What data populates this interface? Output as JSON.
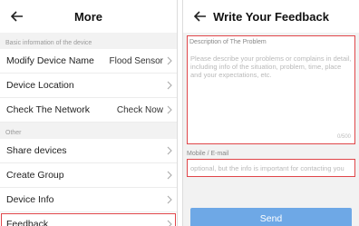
{
  "left": {
    "title": "More",
    "sections": [
      {
        "header": "Basic information of the device",
        "rows": [
          {
            "label": "Modify Device Name",
            "value": "Flood Sensor"
          },
          {
            "label": "Device Location",
            "value": ""
          },
          {
            "label": "Check The Network",
            "value": "Check Now"
          }
        ]
      },
      {
        "header": "Other",
        "rows": [
          {
            "label": "Share devices",
            "value": ""
          },
          {
            "label": "Create Group",
            "value": ""
          },
          {
            "label": "Device Info",
            "value": ""
          },
          {
            "label": "Feedback",
            "value": ""
          }
        ]
      }
    ]
  },
  "right": {
    "title": "Write Your Feedback",
    "problem_label": "Description of The Problem",
    "problem_placeholder": "Please describe your problems or complains in detail, including info of the situation, problem, time, place and your expectations, etc.",
    "counter": "0/500",
    "contact_label": "Mobile / E-mail",
    "contact_placeholder": "optional, but the info is important for contacting you",
    "send_label": "Send"
  },
  "colors": {
    "highlight": "#e0464a",
    "send_button": "#6ea8e6"
  },
  "icons": {
    "back": "back-arrow-icon",
    "chevron": "chevron-right-icon"
  }
}
